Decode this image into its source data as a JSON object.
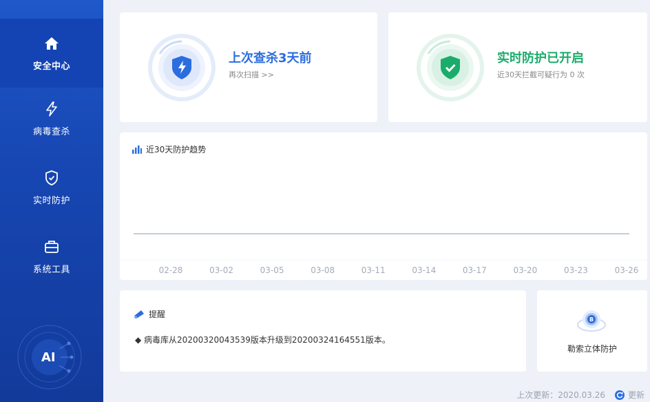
{
  "sidebar": {
    "items": [
      {
        "label": "安全中心",
        "icon": "home-icon",
        "active": true
      },
      {
        "label": "病毒查杀",
        "icon": "lightning-icon",
        "active": false
      },
      {
        "label": "实时防护",
        "icon": "shield-check-icon",
        "active": false
      },
      {
        "label": "系统工具",
        "icon": "toolbox-icon",
        "active": false
      }
    ],
    "ai_badge": "AI"
  },
  "scan_card": {
    "title": "上次查杀3天前",
    "link": "再次扫描 >>",
    "icon": "shield-lightning-icon",
    "color": "#2b6ddf"
  },
  "protect_card": {
    "title": "实时防护已开启",
    "subtitle": "近30天拦截可疑行为 0 次",
    "icon": "shield-check-icon",
    "color": "#1aac6b"
  },
  "trend": {
    "title": "近30天防护趋势",
    "icon": "bar-chart-icon"
  },
  "chart_data": {
    "type": "line",
    "categories": [
      "02-28",
      "03-02",
      "03-05",
      "03-08",
      "03-11",
      "03-14",
      "03-17",
      "03-20",
      "03-23",
      "03-26"
    ],
    "series": [
      {
        "values": [
          0,
          0,
          0,
          0,
          0,
          0,
          0,
          0,
          0,
          0
        ]
      }
    ],
    "title": "近30天防护趋势",
    "xlabel": "",
    "ylabel": "",
    "grid": false
  },
  "notice": {
    "title": "提醒",
    "icon": "bell-icon",
    "line": "◆ 病毒库从20200320043539版本升级到20200324164551版本。"
  },
  "ransom": {
    "label": "勒索立体防护",
    "icon": "ransom-shield-icon"
  },
  "footer": {
    "last_update": "上次更新：2020.03.26",
    "update_label": "更新",
    "icon": "refresh-icon"
  }
}
